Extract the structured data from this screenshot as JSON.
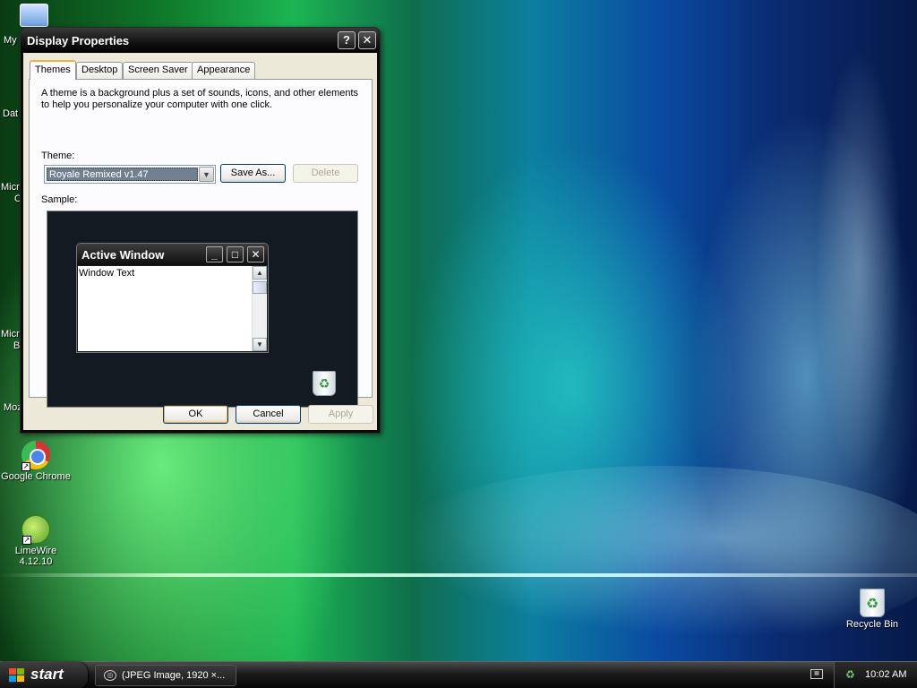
{
  "desktop": {
    "icons": {
      "my_computer": "My",
      "data": "Dat",
      "micro1_line1": "Micro",
      "micro1_line2": "C",
      "micro2_line1": "Micro",
      "micro2_line2": "B",
      "moz": "Moz",
      "chrome": "Google Chrome",
      "limewire_line1": "LimeWire",
      "limewire_line2": "4.12.10",
      "recycle_bin": "Recycle Bin"
    }
  },
  "dialog": {
    "title": "Display Properties",
    "help_glyph": "?",
    "close_glyph": "✕",
    "tabs": [
      {
        "label": "Themes",
        "active": true
      },
      {
        "label": "Desktop",
        "active": false
      },
      {
        "label": "Screen Saver",
        "active": false
      },
      {
        "label": "Appearance",
        "active": false
      }
    ],
    "description": "A theme is a background plus a set of sounds, icons, and other elements to help you personalize your computer with one click.",
    "theme_label": "Theme:",
    "theme_value": "Royale Remixed v1.47",
    "save_as": "Save As...",
    "delete": "Delete",
    "sample_label": "Sample:",
    "sample": {
      "window_title": "Active Window",
      "window_text": "Window Text"
    },
    "buttons": {
      "ok": "OK",
      "cancel": "Cancel",
      "apply": "Apply"
    }
  },
  "taskbar": {
    "start": "start",
    "task": "(JPEG Image, 1920 ×...",
    "clock": "10:02 AM"
  },
  "colors": {
    "start_flag": [
      "#f25022",
      "#7fba00",
      "#00a4ef",
      "#ffb900"
    ],
    "tab_accent": "#f2b33d",
    "selection": "#708090"
  }
}
